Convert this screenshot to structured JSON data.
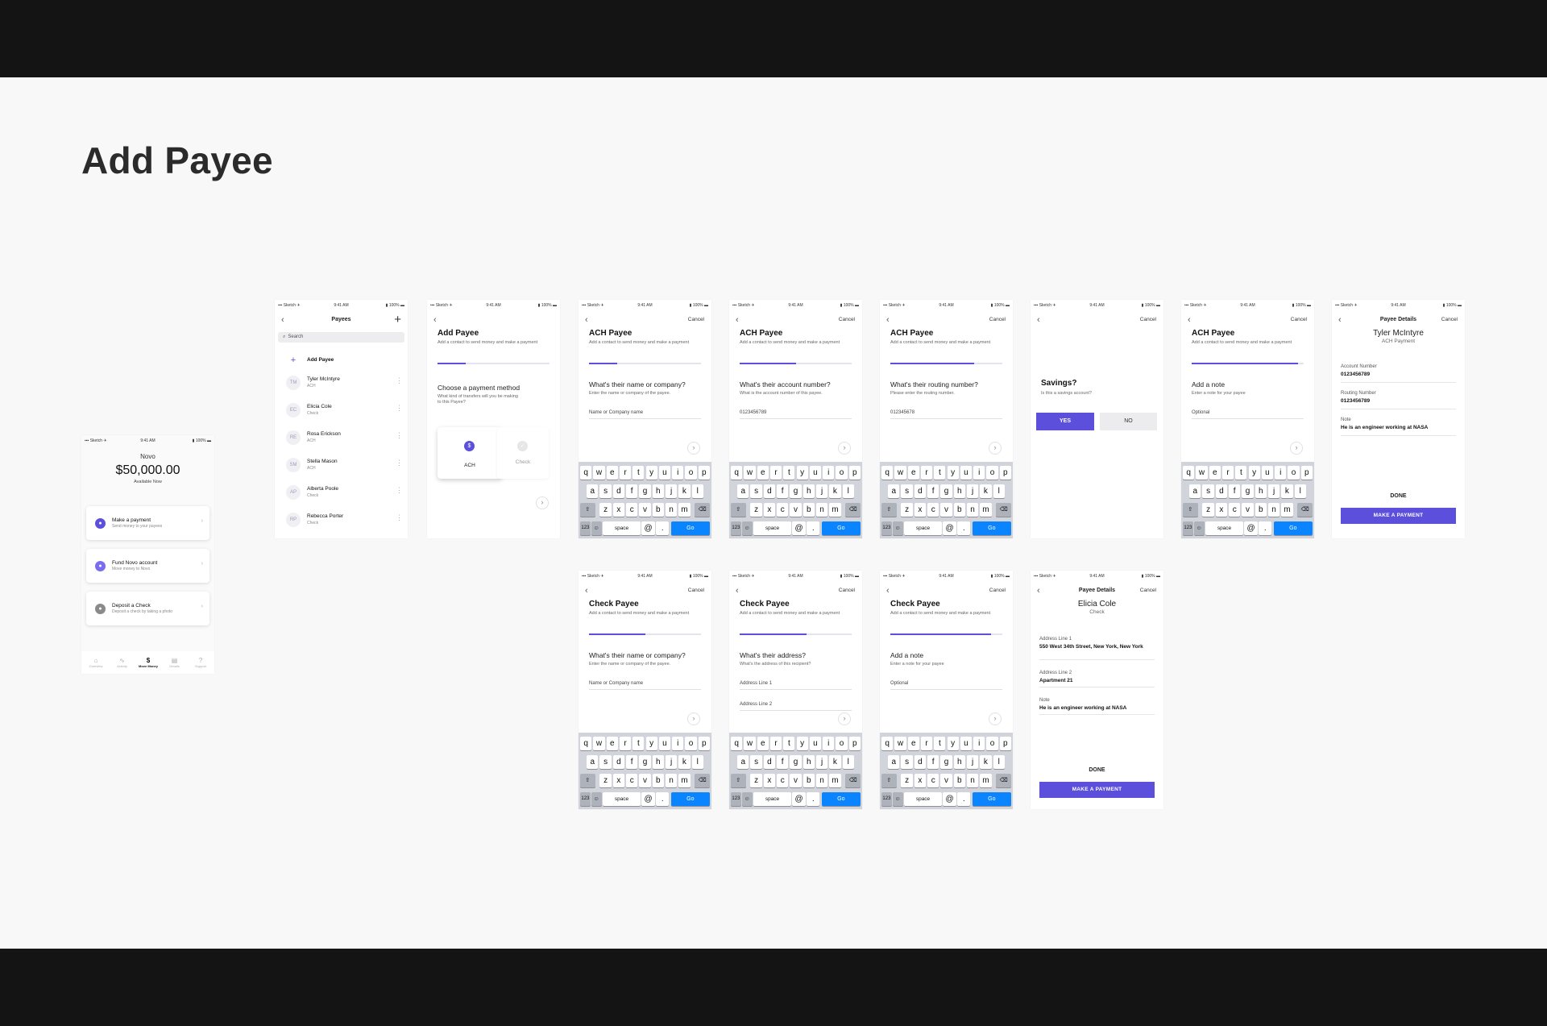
{
  "page": {
    "title": "Add Payee"
  },
  "status_bar": {
    "carrier": "▪▪▪ Sketch ✈",
    "time": "9:41 AM",
    "battery": "▮ 100% ▬"
  },
  "common": {
    "cancel": "Cancel",
    "back_icon": "chevron-left-icon",
    "next_icon": "chevron-right-icon",
    "subtitle": "Add a contact to send money and make a payment",
    "done": "DONE",
    "make_payment": "MAKE A PAYMENT"
  },
  "home": {
    "brand": "Novo",
    "balance": "$50,000.00",
    "balance_label": "Available Now",
    "cards": [
      {
        "title": "Make a payment",
        "subtitle": "Send money to your payees",
        "icon": "dollar-icon",
        "color": "#5b4fdb"
      },
      {
        "title": "Fund Novo account",
        "subtitle": "Move money to Novo",
        "icon": "transfer-icon",
        "color": "#7a6cf0"
      },
      {
        "title": "Deposit a Check",
        "subtitle": "Deposit a check by taking a photo",
        "icon": "camera-icon",
        "color": "#8a8a8a"
      }
    ],
    "tabs": [
      "Overview",
      "Activity",
      "Move Money",
      "Details",
      "Support"
    ]
  },
  "payees": {
    "title": "Payees",
    "search": "Search",
    "add_label": "Add Payee",
    "list": [
      {
        "initials": "TM",
        "name": "Tyler McIntyre",
        "type": "ACH"
      },
      {
        "initials": "EC",
        "name": "Elicia Cole",
        "type": "Check"
      },
      {
        "initials": "RE",
        "name": "Rosa Erickson",
        "type": "ACH"
      },
      {
        "initials": "SM",
        "name": "Stella Mason",
        "type": "ACH"
      },
      {
        "initials": "AP",
        "name": "Alberta Poole",
        "type": "Check"
      },
      {
        "initials": "RP",
        "name": "Rebecca Porter",
        "type": "Check"
      }
    ]
  },
  "method": {
    "title": "Add Payee",
    "question": "Choose a payment method",
    "question_sub": "What kind of transfers will you be making to this Payee?",
    "options": [
      "ACH",
      "Check"
    ],
    "selected": "ACH"
  },
  "ach_steps": [
    {
      "title": "ACH Payee",
      "question": "What's their name or company?",
      "hint": "Enter the name or company of the payee.",
      "field": "Name or Company name",
      "progress": 0.25
    },
    {
      "title": "ACH Payee",
      "question": "What's their account number?",
      "hint": "What is the account number of this payee.",
      "field": "0123456789",
      "progress": 0.5
    },
    {
      "title": "ACH Payee",
      "question": "What's their routing number?",
      "hint": "Please enter the routing number.",
      "field": "012345678",
      "progress": 0.75
    }
  ],
  "savings": {
    "question": "Savings?",
    "hint": "Is this a savings account?",
    "yes": "YES",
    "no": "NO"
  },
  "ach_note": {
    "title": "ACH Payee",
    "question": "Add a note",
    "hint": "Enter a note for your payee",
    "field": "Optional",
    "progress": 0.95
  },
  "ach_details": {
    "header": "Payee Details",
    "name": "Tyler McIntyre",
    "type": "ACH Payment",
    "fields": [
      {
        "label": "Account Number",
        "value": "0123456789"
      },
      {
        "label": "Routing Number",
        "value": "0123456789"
      },
      {
        "label": "Note",
        "value": "He is an engineer working at NASA"
      }
    ]
  },
  "check_steps": [
    {
      "title": "Check Payee",
      "question": "What's their name or company?",
      "hint": "Enter the name or company of the payee.",
      "field": "Name or Company name",
      "progress": 0.5
    },
    {
      "title": "Check Payee",
      "question": "What's their address?",
      "hint": "What's the address of this recipient?",
      "field": "Address Line 1",
      "field2": "Address Line 2",
      "progress": 0.6
    },
    {
      "title": "Check Payee",
      "question": "Add a note",
      "hint": "Enter a note for your payee",
      "field": "Optional",
      "progress": 0.9
    }
  ],
  "check_details": {
    "header": "Payee Details",
    "name": "Elicia Cole",
    "type": "Check",
    "fields": [
      {
        "label": "Address Line 1",
        "value": "550 West 34th Street, New York, New York"
      },
      {
        "label": "Address Line 2",
        "value": "Apartment 21"
      },
      {
        "label": "Note",
        "value": "He is an engineer working at NASA"
      }
    ]
  },
  "keyboard": {
    "row1": [
      "q",
      "w",
      "e",
      "r",
      "t",
      "y",
      "u",
      "i",
      "o",
      "p"
    ],
    "row2": [
      "a",
      "s",
      "d",
      "f",
      "g",
      "h",
      "j",
      "k",
      "l"
    ],
    "row3": [
      "z",
      "x",
      "c",
      "v",
      "b",
      "n",
      "m"
    ],
    "shift": "⇧",
    "delete": "⌫",
    "numbers": "123",
    "emoji": "☺",
    "space": "space",
    "at": "@",
    "dot": ".",
    "go": "Go"
  },
  "colors": {
    "accent": "#5b4fdb",
    "go_key": "#0a84ff",
    "frame": "#141414",
    "canvas": "#f8f8f8"
  }
}
